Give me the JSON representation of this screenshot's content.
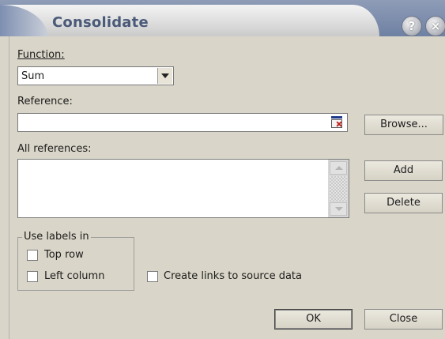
{
  "window": {
    "title": "Consolidate",
    "help_glyph": "?",
    "close_glyph": "×"
  },
  "function": {
    "label": "Function:",
    "selected": "Sum"
  },
  "reference": {
    "label": "Reference:",
    "value": ""
  },
  "all_references": {
    "label": "All references:",
    "items": []
  },
  "buttons": {
    "browse": "Browse...",
    "add": "Add",
    "delete": "Delete",
    "ok": "OK",
    "close": "Close"
  },
  "use_labels": {
    "group_label": "Use labels in",
    "top_row": "Top row",
    "left_column": "Left column"
  },
  "create_links": {
    "label": "Create links to source data"
  },
  "checkbox_states": {
    "top_row": false,
    "left_column": false,
    "create_links": false
  },
  "colors": {
    "dialog_bg": "#d9d5c8",
    "title_text": "#4a5a78",
    "titlebar_blue": "#7d8fb1"
  },
  "icons": {
    "help": "help-icon",
    "close": "close-icon",
    "collapse_dialog": "collapse-dialog-icon",
    "dropdown": "chevron-down-icon"
  }
}
